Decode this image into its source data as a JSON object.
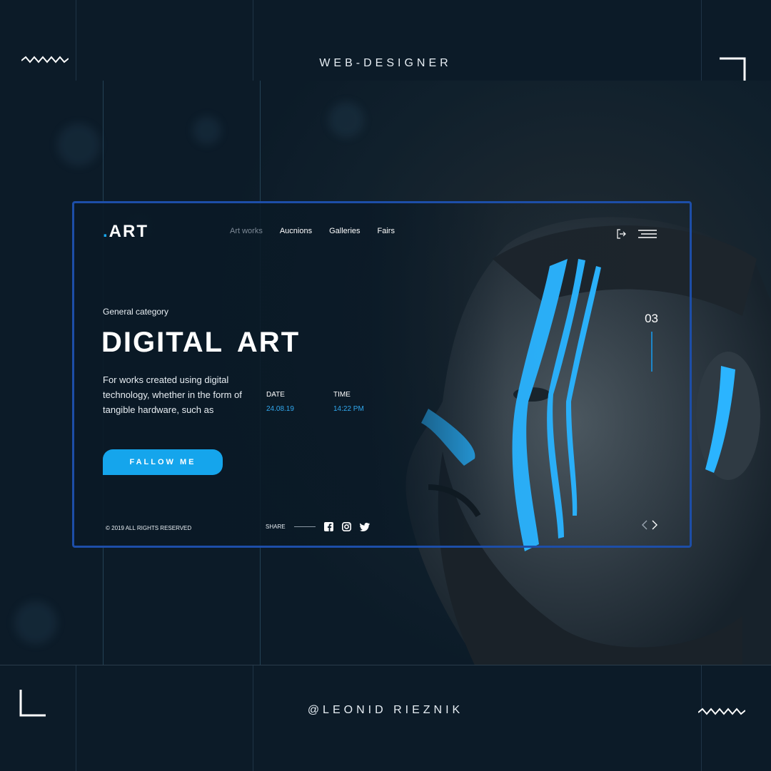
{
  "frame": {
    "top_title": "WEB-DESIGNER",
    "bottom_title": "@LEONID RIEZNIK"
  },
  "site": {
    "logo_dot": ".",
    "logo_text": "ART",
    "nav": [
      {
        "label": "Art works",
        "active": true
      },
      {
        "label": "Aucnions",
        "active": false
      },
      {
        "label": "Galleries",
        "active": false
      },
      {
        "label": "Fairs",
        "active": false
      }
    ],
    "icons": [
      "login-icon",
      "hamburger-menu-icon"
    ]
  },
  "hero": {
    "category": "General category",
    "title": "DIGITAL ART",
    "description": "For works created using digital technology, whether in the form of tangible hardware, such as",
    "date_label": "DATE",
    "date_value": "24.08.19",
    "time_label": "TIME",
    "time_value": "14:22 PM",
    "cta_label": "FALLOW ME",
    "slide_number": "03"
  },
  "footer": {
    "copyright": "© 2019 ALL RIGHTS RESERVED",
    "share_label": "SHARE",
    "social_icons": [
      "facebook-icon",
      "instagram-icon",
      "twitter-icon"
    ]
  },
  "colors": {
    "accent": "#15a5ec",
    "card_border": "#1d4ea8",
    "background": "#0c1b28"
  }
}
